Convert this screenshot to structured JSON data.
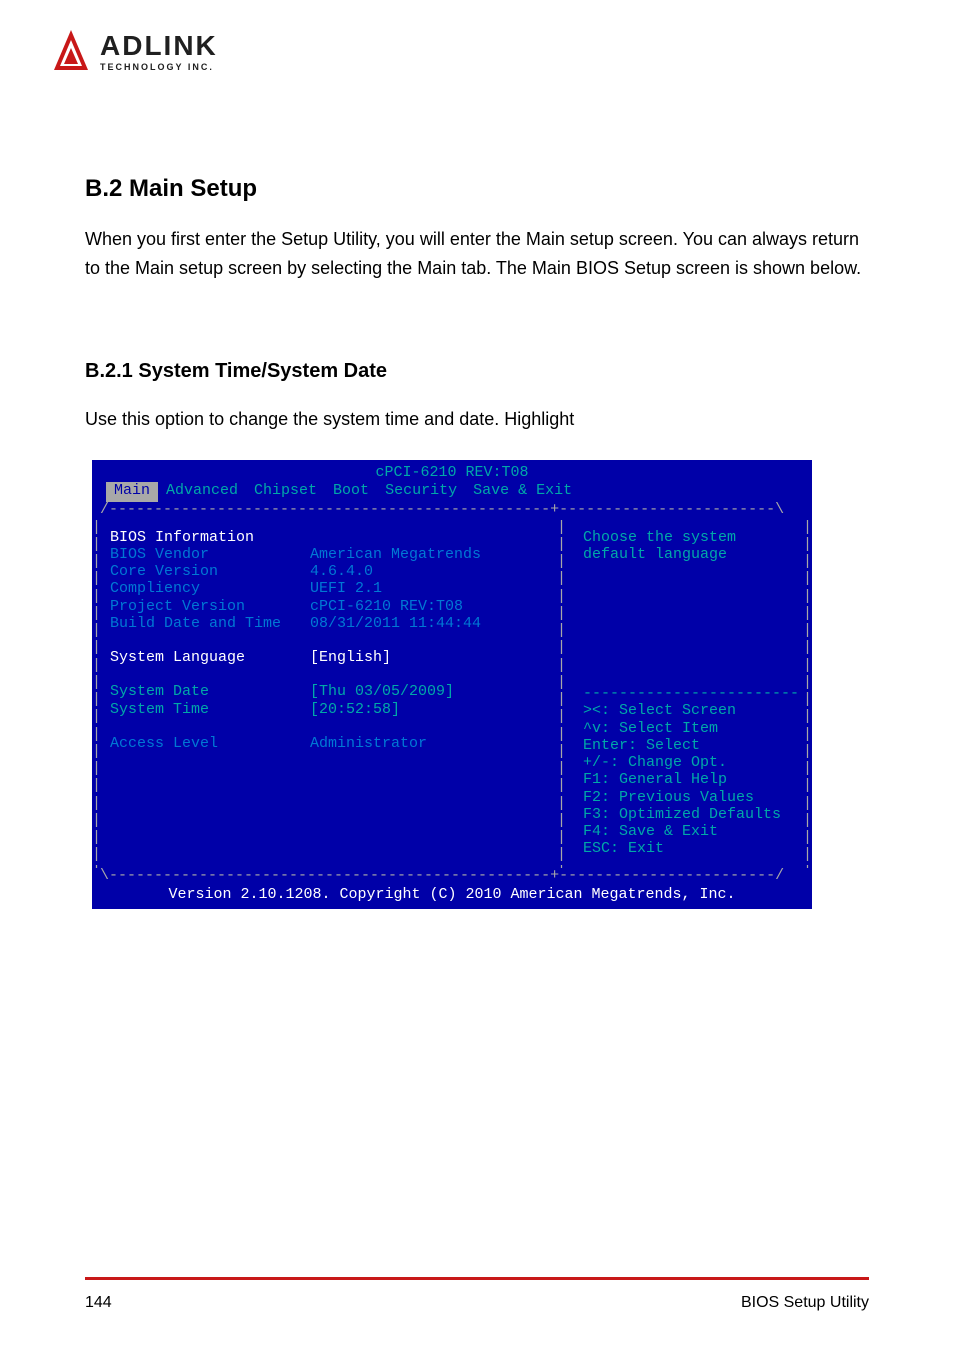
{
  "logo": {
    "brand": "ADLINK",
    "sub": "TECHNOLOGY INC."
  },
  "page": {
    "title": "B.2 Main Setup",
    "intro": "When you first enter the Setup Utility, you will enter the Main setup screen. You can always return to the Main setup screen by selecting the Main tab. The Main BIOS Setup screen is shown below.",
    "subsection": "B.2.1 System Time/System Date",
    "subintro": "Use this option to change the system time and date. Highlight",
    "page_num": "144",
    "manual": "BIOS Setup Utility"
  },
  "bios": {
    "header": "cPCI-6210 REV:T08",
    "tabs": [
      "Main",
      "Advanced",
      "Chipset",
      "Boot",
      "Security",
      "Save & Exit"
    ],
    "active_tab": 0,
    "info_section": "BIOS Information",
    "fields": {
      "vendor_label": "BIOS Vendor",
      "vendor_value": "American Megatrends",
      "core_label": "Core Version",
      "core_value": "4.6.4.0",
      "comp_label": "Compliency",
      "comp_value": "UEFI 2.1",
      "proj_label": "Project Version",
      "proj_value": "cPCI-6210 REV:T08",
      "build_label": "Build Date and Time",
      "build_value": "08/31/2011 11:44:44",
      "lang_label": "System Language",
      "lang_value": "[English]",
      "date_label": "System Date",
      "date_value": "[Thu 03/05/2009]",
      "time_label": "System Time",
      "time_value": "[20:52:58]",
      "access_label": "Access Level",
      "access_value": "Administrator"
    },
    "help": {
      "line1": "Choose the system",
      "line2": "default language"
    },
    "keys": [
      "><: Select Screen",
      "^v: Select Item",
      "Enter: Select",
      "+/-: Change Opt.",
      "F1: General Help",
      "F2: Previous Values",
      "F3: Optimized Defaults",
      "F4: Save & Exit",
      "ESC: Exit"
    ],
    "footer": "Version 2.10.1208. Copyright (C) 2010 American Megatrends, Inc."
  }
}
